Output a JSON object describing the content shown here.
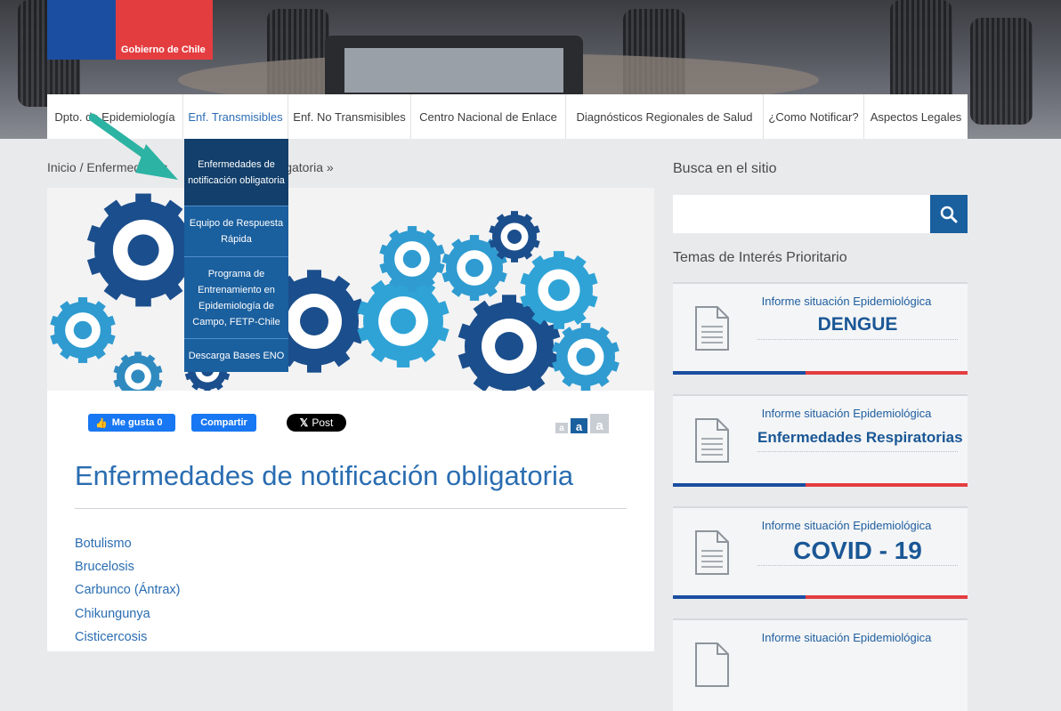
{
  "header": {
    "brand": "Gobierno de Chile"
  },
  "nav": {
    "items": [
      {
        "label": "Dpto. de Epidemiología",
        "active": false
      },
      {
        "label": "Enf. Transmisibles",
        "active": true
      },
      {
        "label": "Enf. No Transmisibles",
        "active": false
      },
      {
        "label": "Centro Nacional de Enlace",
        "active": false
      },
      {
        "label": "Diagnósticos Regionales de Salud",
        "active": false
      },
      {
        "label": "¿Como Notificar?",
        "active": false
      },
      {
        "label": "Aspectos Legales",
        "active": false
      }
    ],
    "dropdown": [
      "Enfermedades de notificación obligatoria",
      "Equipo de Respuesta Rápida",
      "Programa de Entrenamiento en Epidemiología de Campo, FETP-Chile",
      "Descarga Bases ENO"
    ]
  },
  "breadcrumb": {
    "home": "Inicio",
    "sep": "/",
    "section": "Enfermedades",
    "tail": "obligatoria »"
  },
  "social": {
    "like": "Me gusta 0",
    "share": "Compartir",
    "post": "Post"
  },
  "text_size": [
    "a",
    "a",
    "a"
  ],
  "page": {
    "title": "Enfermedades de notificación obligatoria",
    "diseases": [
      "Botulismo",
      "Brucelosis",
      "Carbunco (Ántrax)",
      "Chikungunya",
      "Cisticercosis"
    ]
  },
  "sidebar": {
    "search_title": "Busca en el sitio",
    "search_placeholder": "",
    "topics_title": "Temas de Interés Prioritario",
    "cards": [
      {
        "subtitle": "Informe situación Epidemiológica",
        "title": "DENGUE"
      },
      {
        "subtitle": "Informe situación Epidemiológica",
        "title": "Enfermedades Respiratorias"
      },
      {
        "subtitle": "Informe situación Epidemiológica",
        "title": "COVID - 19"
      },
      {
        "subtitle": "Informe situación Epidemiológica",
        "title": ""
      }
    ]
  },
  "colors": {
    "brand_blue": "#1b4ea1",
    "brand_red": "#e43d40",
    "link_blue": "#2a6db1",
    "dropdown": "#1a5f9e"
  }
}
